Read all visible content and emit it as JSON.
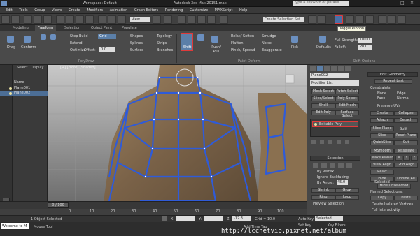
{
  "titlebar": {
    "workspace": "Workspace: Default",
    "app_title": "Autodesk 3ds Max 2015",
    "file_name": "1.max",
    "search_placeholder": "Type a keyword or phrase"
  },
  "menubar": {
    "items": [
      "Edit",
      "Tools",
      "Group",
      "Views",
      "Create",
      "Modifiers",
      "Animation",
      "Graph Editors",
      "Rendering",
      "Customize",
      "MAXScript",
      "Help"
    ]
  },
  "toolbar": {
    "view_dropdown": "View",
    "selection_set": "Create Selection Set",
    "tooltip": "Toggle Ribbon"
  },
  "ribbon_tabs": [
    "Modeling",
    "Freeform",
    "Selection",
    "Object Paint",
    "Populate"
  ],
  "ribbon": {
    "left_group": [
      "Drag",
      "Conform"
    ],
    "step_build": "Step Build",
    "extend": "Extend",
    "optimize": "Optimize",
    "grid_dropdown": "Grid",
    "offset_label": "Offset:",
    "offset_value": "0.0",
    "shapes": "Shapes",
    "splines": "Splines",
    "surface": "Surface",
    "topology": "Topology",
    "strips": "Strips",
    "branches": "Branches",
    "shift_label": "Shift",
    "push_pull": "Push/ Pull",
    "relax_soften": "Relax/ Soften",
    "flatten": "Flatten",
    "pinch_spread": "Pinch/ Spread",
    "smudge": "Smudge",
    "noise": "Noise",
    "exaggerate": "Exaggerate",
    "pick": "Pick",
    "defaults": "Defaults",
    "full_strength": "Full Strength:",
    "full_strength_value": "100.0",
    "falloff": "Falloff:",
    "falloff_value": "20.0",
    "polydraw_title": "PolyDraw",
    "paint_deform_title": "Paint Deform",
    "shift_options_title": "Shift Options"
  },
  "scene_explorer": {
    "tabs": [
      "Select",
      "Display"
    ],
    "column_header": "Name",
    "objects": [
      "Plane001",
      "Plane002"
    ],
    "selected_index": 1
  },
  "viewport": {
    "label": "[+] [Front] [Shaded]"
  },
  "command_panel": {
    "object_name": "Plane002",
    "modifier_list": "Modifier List",
    "mod_buttons": [
      "Mesh Select",
      "Patch Select",
      "Slice/Select",
      "Poly Select",
      "Shell",
      "Edit Mesh",
      "Edit Poly",
      "Surface Select"
    ],
    "stack_item": "Editable Poly",
    "selection_rollout": "Selection",
    "by_vertex": "By Vertex",
    "ignore_backfacing": "Ignore Backfacing",
    "by_angle": "By Angle:",
    "by_angle_value": "45.0",
    "shrink": "Shrink",
    "grow": "Grow",
    "ring": "Ring",
    "loop": "Loop",
    "preview_selection": "Preview Selection"
  },
  "edit_geometry": {
    "title": "Edit Geometry",
    "repeat_last": "Repeat Last",
    "constraints": "Constraints",
    "none": "None",
    "edge": "Edge",
    "face": "Face",
    "normal": "Normal",
    "preserve_uvs": "Preserve UVs",
    "create": "Create",
    "collapse": "Collapse",
    "attach": "Attach",
    "detach": "Detach",
    "slice_plane": "Slice Plane",
    "split": "Split",
    "slice": "Slice",
    "reset_plane": "Reset Plane",
    "quickslice": "QuickSlice",
    "cut": "Cut",
    "msmooth": "MSmooth",
    "tessellate": "Tessellate",
    "make_planar": "Make Planar",
    "x": "X",
    "y": "Y",
    "z": "Z",
    "view_align": "View Align",
    "grid_align": "Grid Align",
    "relax": "Relax",
    "hide_selected": "Hide Selected",
    "unhide_all": "Unhide All",
    "hide_unselected": "Hide Unselected",
    "named_selections": "Named Selections:",
    "copy": "Copy",
    "paste": "Paste",
    "delete_isolated": "Delete Isolated Vertices",
    "full_interactivity": "Full Interactivity"
  },
  "timeline": {
    "frame_counter": "0 / 100",
    "ticks": [
      "0",
      "10",
      "20",
      "30",
      "40",
      "50",
      "60",
      "70",
      "80",
      "90",
      "100"
    ]
  },
  "statusbar": {
    "selected": "1 Object Selected",
    "x_label": "X:",
    "y_label": "Y:",
    "z_label": "Z:",
    "z_value": "-12.3",
    "grid": "Grid = 10.0",
    "auto_key": "Auto Key",
    "selected_dropdown": "Selected",
    "set_key": "Set Key",
    "key_filters": "Key Filters...",
    "add_time_tag": "Add Time Tag",
    "mouse_tool": "Mouse Tool",
    "prompt": "Welcome to M",
    "watermark": "http://lccnetvip.pixnet.net/album"
  },
  "colors": {
    "wire": "#2f5bd8",
    "highlight": "#e03a3a",
    "selection": "#4c6e96",
    "accent": "#6b8fbf"
  }
}
